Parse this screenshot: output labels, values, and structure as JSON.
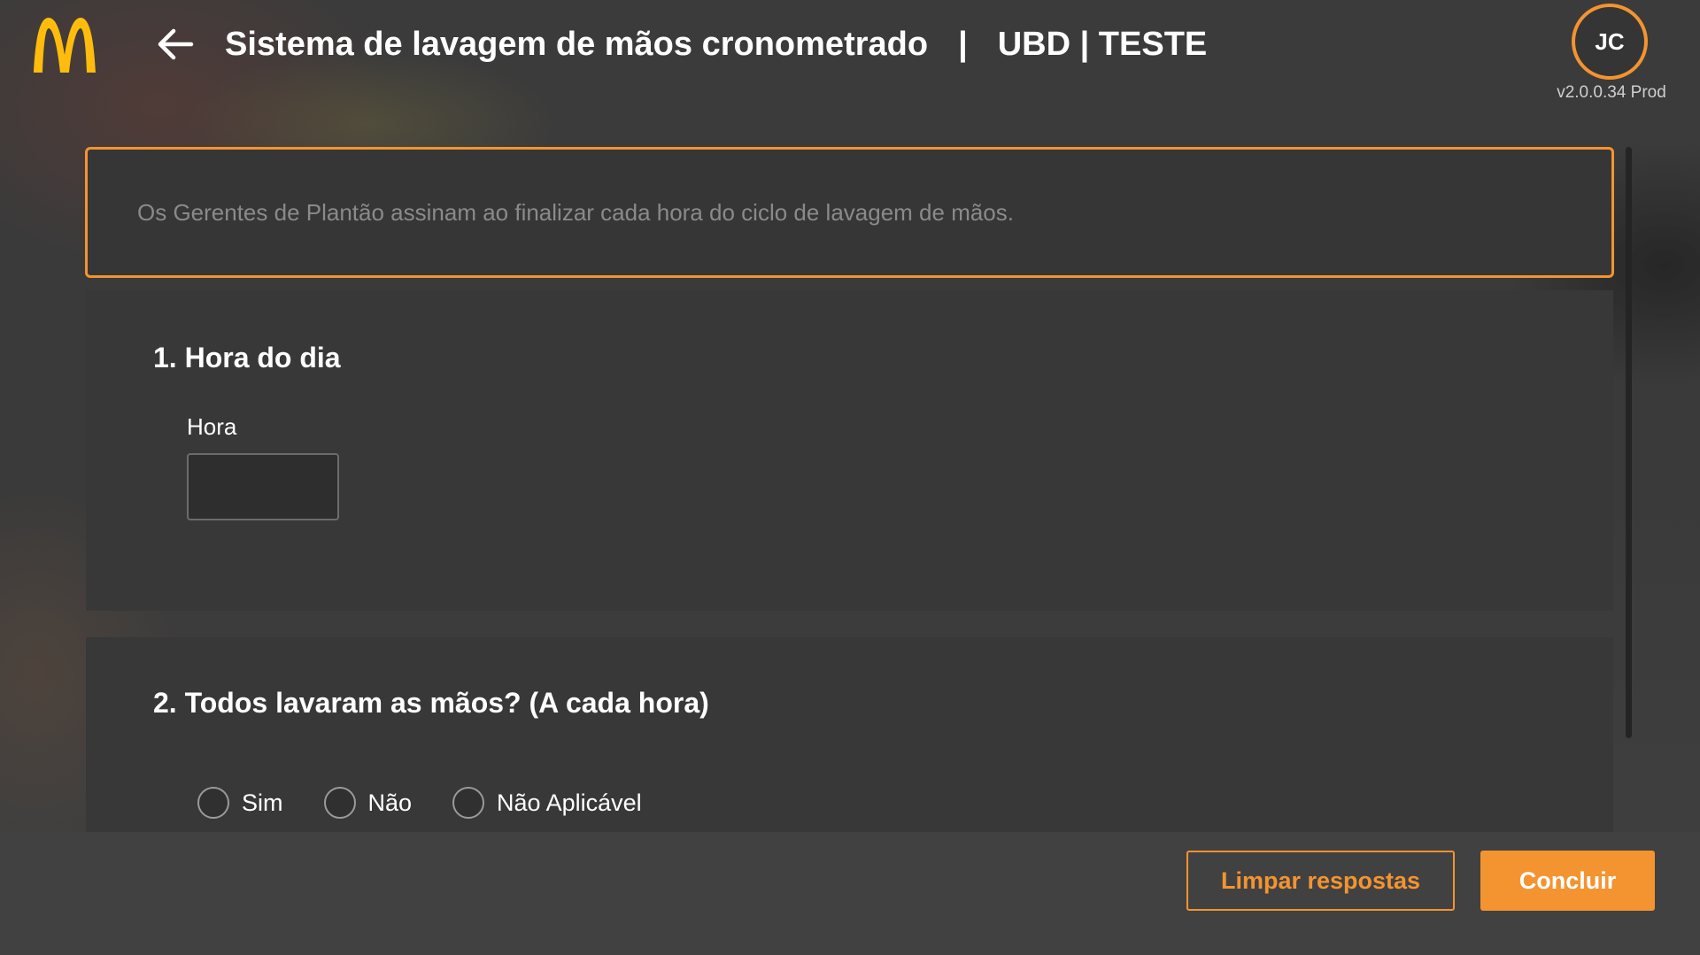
{
  "header": {
    "logo_icon": "mcdonalds-arches-logo",
    "back_icon": "arrow-left-icon",
    "title": "Sistema de lavagem de mãos cronometrado",
    "separator": "|",
    "store": "UBD | TESTE",
    "avatar_initials": "JC",
    "version": "v2.0.0.34 Prod"
  },
  "info": {
    "text": "Os Gerentes de Plantão assinam ao finalizar cada hora do ciclo de lavagem de mãos."
  },
  "questions": [
    {
      "title": "1. Hora do dia",
      "field_label": "Hora",
      "value": ""
    },
    {
      "title": "2. Todos lavaram as mãos? (A cada hora)",
      "options": [
        "Sim",
        "Não",
        "Não Aplicável"
      ]
    }
  ],
  "footer": {
    "clear_label": "Limpar respostas",
    "done_label": "Concluir"
  },
  "colors": {
    "accent": "#f39431",
    "logo": "#ffbc0d",
    "background": "#3a3a3a"
  }
}
